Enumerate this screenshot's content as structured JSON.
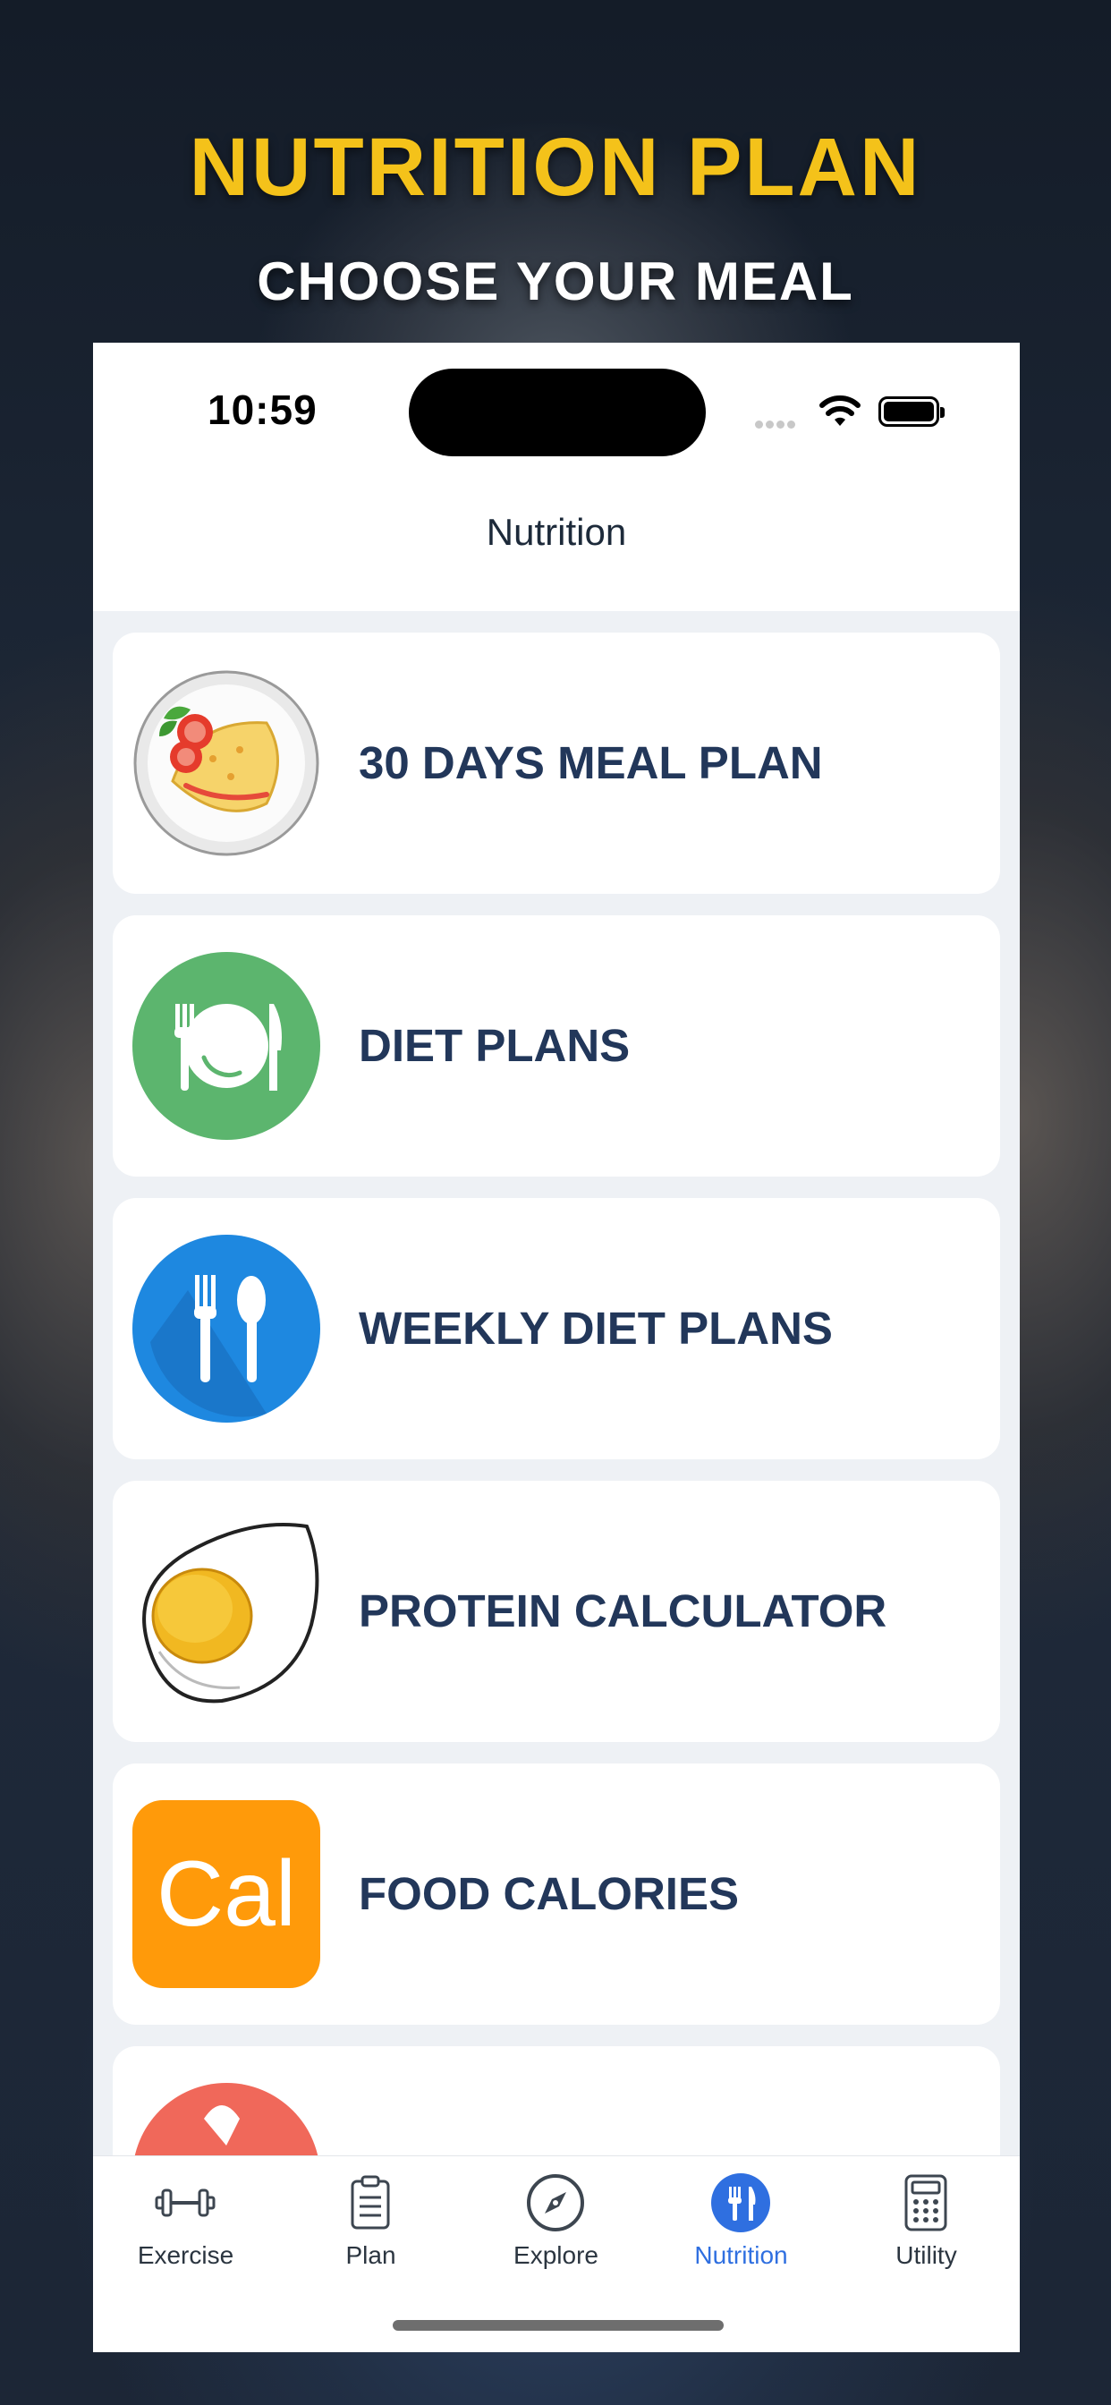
{
  "promo": {
    "headline": "NUTRITION PLAN",
    "subheadline": "CHOOSE YOUR MEAL"
  },
  "status_bar": {
    "time": "10:59"
  },
  "nav": {
    "title": "Nutrition"
  },
  "menu_items": [
    {
      "label": "30 DAYS MEAL PLAN",
      "icon": "omelette-plate-icon"
    },
    {
      "label": "DIET PLANS",
      "icon": "plate-fork-knife-icon"
    },
    {
      "label": "WEEKLY DIET PLANS",
      "icon": "fork-spoon-icon"
    },
    {
      "label": "PROTEIN CALCULATOR",
      "icon": "boiled-egg-icon"
    },
    {
      "label": "FOOD CALORIES",
      "icon": "cal-icon",
      "icon_text": "Cal"
    }
  ],
  "tabs": [
    {
      "label": "Exercise",
      "icon": "dumbbell-icon",
      "active": false
    },
    {
      "label": "Plan",
      "icon": "clipboard-icon",
      "active": false
    },
    {
      "label": "Explore",
      "icon": "compass-icon",
      "active": false
    },
    {
      "label": "Nutrition",
      "icon": "fork-knife-icon",
      "active": true
    },
    {
      "label": "Utility",
      "icon": "calculator-icon",
      "active": false
    }
  ],
  "colors": {
    "headline": "#f4c21a",
    "label_text": "#22375a",
    "active_tab": "#2f6fe0",
    "green_icon": "#5cb56e",
    "blue_icon": "#1e88e0",
    "orange_icon": "#ff9a0a",
    "red_icon": "#f0685a"
  }
}
